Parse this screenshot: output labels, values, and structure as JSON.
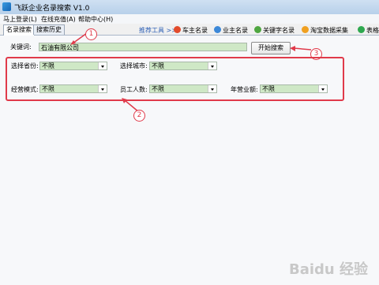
{
  "window": {
    "title": "飞跃企业名录搜索 V1.0"
  },
  "menu": {
    "items": [
      "马上登录(L)",
      "在线充值(A)",
      "帮助中心(H)"
    ]
  },
  "tabs": [
    {
      "label": "名录搜索"
    },
    {
      "label": "搜索历史"
    }
  ],
  "toolbar": {
    "recommend_label": "推荐工具 >>",
    "tools": [
      {
        "label": "车主名录",
        "icon": "car-icon"
      },
      {
        "label": "业主名录",
        "icon": "house-icon"
      },
      {
        "label": "关键字名录",
        "icon": "search-icon"
      },
      {
        "label": "淘宝数据采集",
        "icon": "shop-icon"
      },
      {
        "label": "表格",
        "icon": "table-icon"
      }
    ]
  },
  "form": {
    "keyword_label": "关键词:",
    "keyword_value": "石油有限公司",
    "search_button": "开始搜索",
    "province_label": "选择省份:",
    "province_value": "不限",
    "city_label": "选择城市:",
    "city_value": "不限",
    "mode_label": "经营模式:",
    "mode_value": "不限",
    "staff_label": "员工人数:",
    "staff_value": "不限",
    "revenue_label": "年营业额:",
    "revenue_value": "不限"
  },
  "annotations": {
    "badge1": "1",
    "badge2": "2",
    "badge3": "3"
  },
  "watermark": "Baidu 经验",
  "colors": {
    "annotation_red": "#e03a4a",
    "field_green": "#cfe8c6"
  }
}
